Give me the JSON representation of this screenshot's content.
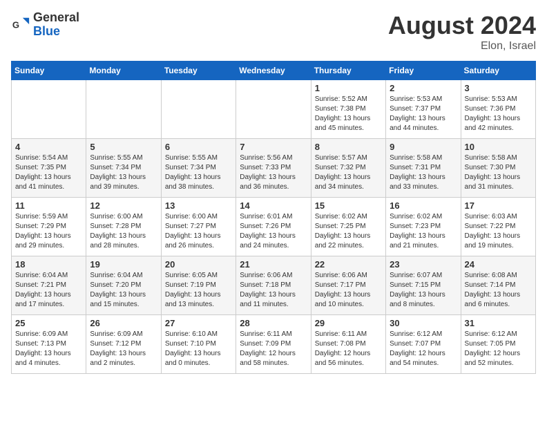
{
  "header": {
    "logo_general": "General",
    "logo_blue": "Blue",
    "month_title": "August 2024",
    "location": "Elon, Israel"
  },
  "weekdays": [
    "Sunday",
    "Monday",
    "Tuesday",
    "Wednesday",
    "Thursday",
    "Friday",
    "Saturday"
  ],
  "weeks": [
    [
      {
        "day": "",
        "info": ""
      },
      {
        "day": "",
        "info": ""
      },
      {
        "day": "",
        "info": ""
      },
      {
        "day": "",
        "info": ""
      },
      {
        "day": "1",
        "info": "Sunrise: 5:52 AM\nSunset: 7:38 PM\nDaylight: 13 hours and 45 minutes."
      },
      {
        "day": "2",
        "info": "Sunrise: 5:53 AM\nSunset: 7:37 PM\nDaylight: 13 hours and 44 minutes."
      },
      {
        "day": "3",
        "info": "Sunrise: 5:53 AM\nSunset: 7:36 PM\nDaylight: 13 hours and 42 minutes."
      }
    ],
    [
      {
        "day": "4",
        "info": "Sunrise: 5:54 AM\nSunset: 7:35 PM\nDaylight: 13 hours and 41 minutes."
      },
      {
        "day": "5",
        "info": "Sunrise: 5:55 AM\nSunset: 7:34 PM\nDaylight: 13 hours and 39 minutes."
      },
      {
        "day": "6",
        "info": "Sunrise: 5:55 AM\nSunset: 7:34 PM\nDaylight: 13 hours and 38 minutes."
      },
      {
        "day": "7",
        "info": "Sunrise: 5:56 AM\nSunset: 7:33 PM\nDaylight: 13 hours and 36 minutes."
      },
      {
        "day": "8",
        "info": "Sunrise: 5:57 AM\nSunset: 7:32 PM\nDaylight: 13 hours and 34 minutes."
      },
      {
        "day": "9",
        "info": "Sunrise: 5:58 AM\nSunset: 7:31 PM\nDaylight: 13 hours and 33 minutes."
      },
      {
        "day": "10",
        "info": "Sunrise: 5:58 AM\nSunset: 7:30 PM\nDaylight: 13 hours and 31 minutes."
      }
    ],
    [
      {
        "day": "11",
        "info": "Sunrise: 5:59 AM\nSunset: 7:29 PM\nDaylight: 13 hours and 29 minutes."
      },
      {
        "day": "12",
        "info": "Sunrise: 6:00 AM\nSunset: 7:28 PM\nDaylight: 13 hours and 28 minutes."
      },
      {
        "day": "13",
        "info": "Sunrise: 6:00 AM\nSunset: 7:27 PM\nDaylight: 13 hours and 26 minutes."
      },
      {
        "day": "14",
        "info": "Sunrise: 6:01 AM\nSunset: 7:26 PM\nDaylight: 13 hours and 24 minutes."
      },
      {
        "day": "15",
        "info": "Sunrise: 6:02 AM\nSunset: 7:25 PM\nDaylight: 13 hours and 22 minutes."
      },
      {
        "day": "16",
        "info": "Sunrise: 6:02 AM\nSunset: 7:23 PM\nDaylight: 13 hours and 21 minutes."
      },
      {
        "day": "17",
        "info": "Sunrise: 6:03 AM\nSunset: 7:22 PM\nDaylight: 13 hours and 19 minutes."
      }
    ],
    [
      {
        "day": "18",
        "info": "Sunrise: 6:04 AM\nSunset: 7:21 PM\nDaylight: 13 hours and 17 minutes."
      },
      {
        "day": "19",
        "info": "Sunrise: 6:04 AM\nSunset: 7:20 PM\nDaylight: 13 hours and 15 minutes."
      },
      {
        "day": "20",
        "info": "Sunrise: 6:05 AM\nSunset: 7:19 PM\nDaylight: 13 hours and 13 minutes."
      },
      {
        "day": "21",
        "info": "Sunrise: 6:06 AM\nSunset: 7:18 PM\nDaylight: 13 hours and 11 minutes."
      },
      {
        "day": "22",
        "info": "Sunrise: 6:06 AM\nSunset: 7:17 PM\nDaylight: 13 hours and 10 minutes."
      },
      {
        "day": "23",
        "info": "Sunrise: 6:07 AM\nSunset: 7:15 PM\nDaylight: 13 hours and 8 minutes."
      },
      {
        "day": "24",
        "info": "Sunrise: 6:08 AM\nSunset: 7:14 PM\nDaylight: 13 hours and 6 minutes."
      }
    ],
    [
      {
        "day": "25",
        "info": "Sunrise: 6:09 AM\nSunset: 7:13 PM\nDaylight: 13 hours and 4 minutes."
      },
      {
        "day": "26",
        "info": "Sunrise: 6:09 AM\nSunset: 7:12 PM\nDaylight: 13 hours and 2 minutes."
      },
      {
        "day": "27",
        "info": "Sunrise: 6:10 AM\nSunset: 7:10 PM\nDaylight: 13 hours and 0 minutes."
      },
      {
        "day": "28",
        "info": "Sunrise: 6:11 AM\nSunset: 7:09 PM\nDaylight: 12 hours and 58 minutes."
      },
      {
        "day": "29",
        "info": "Sunrise: 6:11 AM\nSunset: 7:08 PM\nDaylight: 12 hours and 56 minutes."
      },
      {
        "day": "30",
        "info": "Sunrise: 6:12 AM\nSunset: 7:07 PM\nDaylight: 12 hours and 54 minutes."
      },
      {
        "day": "31",
        "info": "Sunrise: 6:12 AM\nSunset: 7:05 PM\nDaylight: 12 hours and 52 minutes."
      }
    ]
  ]
}
